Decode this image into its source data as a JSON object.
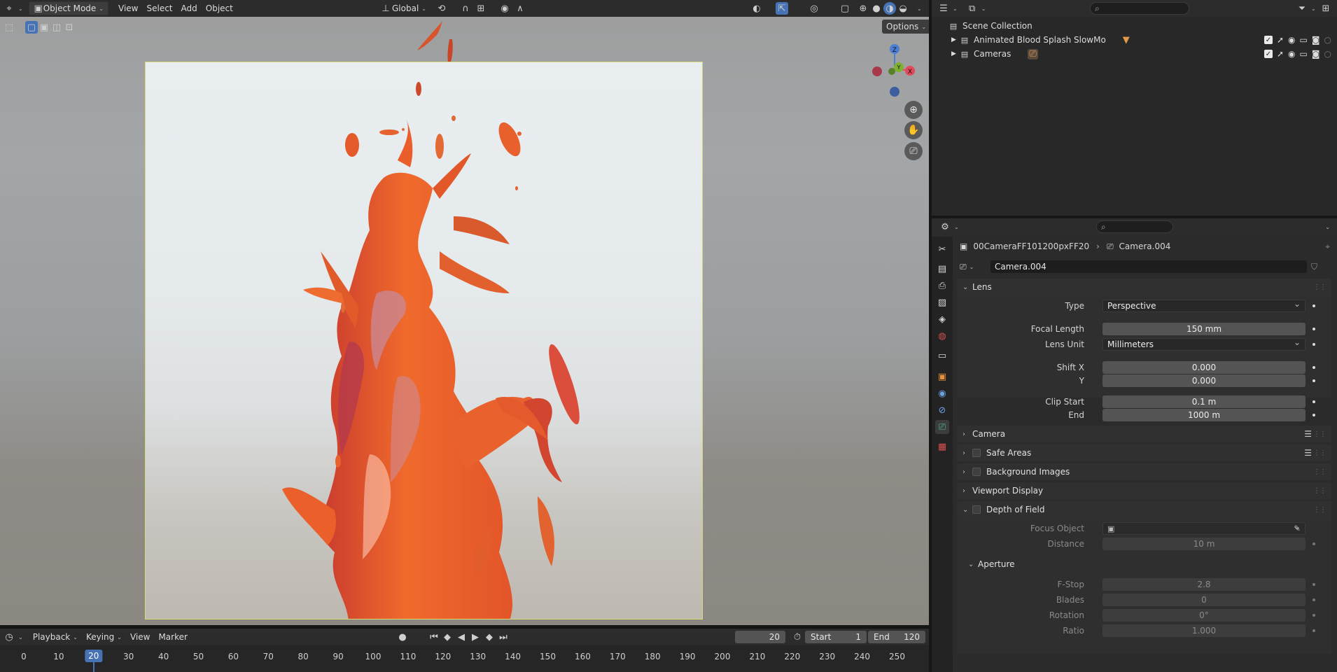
{
  "viewport": {
    "header": {
      "mode": "Object Mode",
      "menus": [
        "View",
        "Select",
        "Add",
        "Object"
      ],
      "transform_orientation": "Global"
    },
    "options_label": "Options",
    "gizmo": {
      "z": "Z",
      "y": "Y",
      "x": "X"
    }
  },
  "timeline": {
    "menus": [
      "Playback",
      "Keying",
      "View",
      "Marker"
    ],
    "current_frame": "20",
    "start_label": "Start",
    "start_value": "1",
    "end_label": "End",
    "end_value": "120",
    "ticks": [
      "0",
      "10",
      "20",
      "30",
      "40",
      "50",
      "60",
      "70",
      "80",
      "90",
      "100",
      "110",
      "120",
      "130",
      "140",
      "150",
      "160",
      "170",
      "180",
      "190",
      "200",
      "210",
      "220",
      "230",
      "240",
      "250"
    ],
    "playhead": "20"
  },
  "outliner": {
    "root": "Scene Collection",
    "items": [
      {
        "label": "Animated Blood Splash SlowMo"
      },
      {
        "label": "Cameras"
      }
    ]
  },
  "properties": {
    "breadcrumb_object": "00CameraFF101200pxFF20",
    "breadcrumb_data": "Camera.004",
    "data_name": "Camera.004",
    "lens": {
      "title": "Lens",
      "type_label": "Type",
      "type_value": "Perspective",
      "focal_label": "Focal Length",
      "focal_value": "150 mm",
      "unit_label": "Lens Unit",
      "unit_value": "Millimeters",
      "shiftx_label": "Shift X",
      "shiftx_value": "0.000",
      "shifty_label": "Y",
      "shifty_value": "0.000",
      "clipstart_label": "Clip Start",
      "clipstart_value": "0.1 m",
      "clipend_label": "End",
      "clipend_value": "1000 m"
    },
    "panels": {
      "camera": "Camera",
      "safe_areas": "Safe Areas",
      "background_images": "Background Images",
      "viewport_display": "Viewport Display",
      "dof": "Depth of Field"
    },
    "dof": {
      "focus_label": "Focus Object",
      "distance_label": "Distance",
      "distance_value": "10 m",
      "aperture_title": "Aperture",
      "fstop_label": "F-Stop",
      "fstop_value": "2.8",
      "blades_label": "Blades",
      "blades_value": "0",
      "rotation_label": "Rotation",
      "rotation_value": "0°",
      "ratio_label": "Ratio",
      "ratio_value": "1.000"
    }
  },
  "colors": {
    "accent": "#4772b3",
    "frame_border": "#d9d97a",
    "splash": "#e8582a"
  }
}
